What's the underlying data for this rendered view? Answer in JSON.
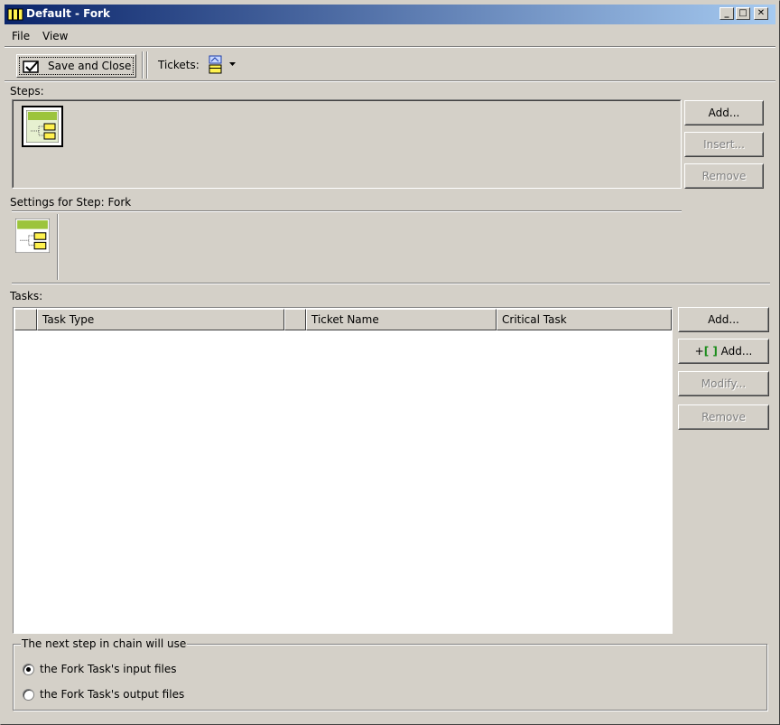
{
  "window": {
    "title": "Default - Fork",
    "minimize_glyph": "_",
    "maximize_glyph": "□",
    "close_glyph": "✕"
  },
  "menu": {
    "items": [
      {
        "label": "File"
      },
      {
        "label": "View"
      }
    ]
  },
  "toolbar": {
    "save_close_label": "Save and Close",
    "tickets_label": "Tickets:"
  },
  "steps": {
    "label": "Steps:",
    "buttons": {
      "add": "Add...",
      "insert": "Insert...",
      "remove": "Remove"
    }
  },
  "settings": {
    "label": "Settings for Step: Fork"
  },
  "tasks": {
    "label": "Tasks:",
    "columns": [
      "",
      "Task Type",
      "",
      "Ticket Name",
      "Critical Task"
    ],
    "rows": [],
    "buttons": {
      "add": "Add...",
      "add_bracket_prefix": "+",
      "add_bracket_icon": "[ ]",
      "add_bracket": "Add...",
      "modify": "Modify...",
      "remove": "Remove"
    }
  },
  "chain": {
    "legend": "The next step in chain will use",
    "options": [
      {
        "label": "the Fork Task's input files",
        "checked": true
      },
      {
        "label": "the Fork Task's output files",
        "checked": false
      }
    ]
  },
  "colors": {
    "titlebar_start": "#0a246a",
    "titlebar_end": "#a6caf0",
    "face": "#d4d0c8",
    "step_icon_green": "#9cc43c",
    "ticket_yellow": "#fff24f",
    "bracket_green": "#1a8c1a"
  },
  "icons": {
    "app": "ticket-icon",
    "save": "checkbox-save-icon",
    "tickets": "ticket-stack-icon",
    "step": "fork-step-icon"
  }
}
